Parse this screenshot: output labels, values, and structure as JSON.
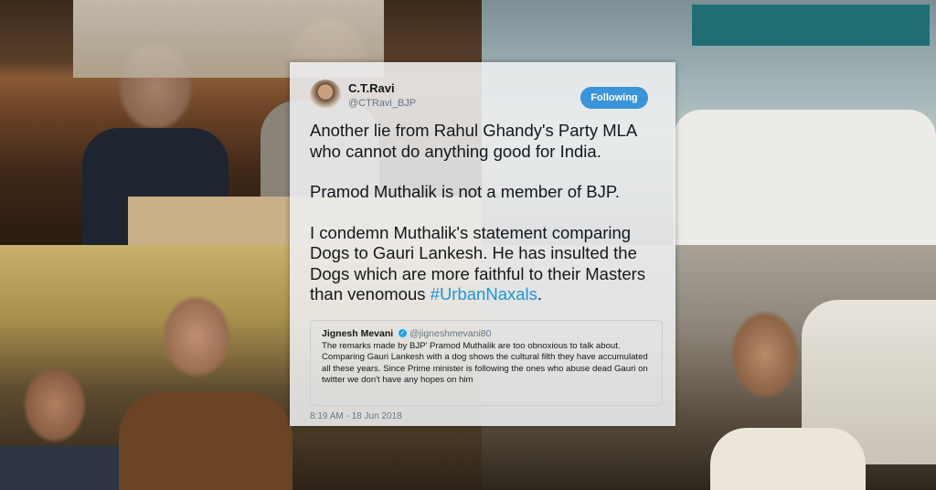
{
  "photos": [
    {
      "name": "cafe-photo"
    },
    {
      "name": "airport-photo"
    },
    {
      "name": "indoor-group-photo"
    },
    {
      "name": "car-park-photo"
    }
  ],
  "tweet": {
    "author_name": "C.T.Ravi",
    "author_handle": "@CTRavi_BJP",
    "follow_label": "Following",
    "paragraphs": [
      "Another lie from Rahul Ghandy's Party MLA who cannot do anything good for India.",
      "Pramod Muthalik is not a member of BJP."
    ],
    "paragraph3_text": "I condemn Muthalik's statement comparing Dogs to Gauri Lankesh. He has insulted the Dogs which are more faithful to their Masters than venomous ",
    "hashtag": "#UrbanNaxals",
    "paragraph3_end": ".",
    "quote": {
      "name": "Jignesh Mevani",
      "handle": "@jigneshmevani80",
      "text": "The remarks made by BJP' Pramod Muthalik are too obnoxious to talk about. Comparing Gauri Lankesh with a dog shows the cultural filth they have accumulated all these years. Since Prime minister is following the ones who abuse dead Gauri on twitter we don't have any hopes on him"
    },
    "timestamp": "8:19 AM - 18 Jun 2018"
  },
  "colors": {
    "follow_button": "#3b94d9",
    "hashtag": "#1b95e0",
    "verified": "#1da1f2"
  }
}
